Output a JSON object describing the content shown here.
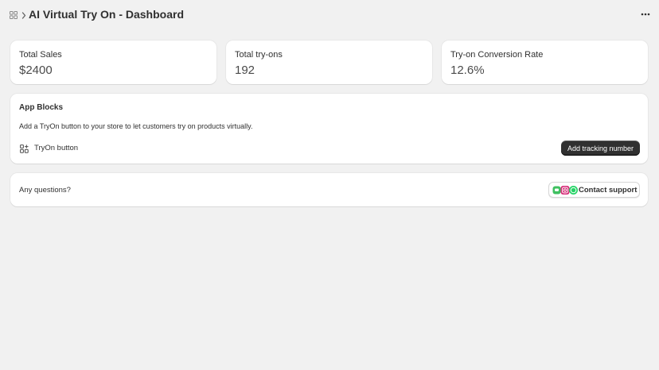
{
  "header": {
    "title": "AI Virtual Try On - Dashboard"
  },
  "stats": [
    {
      "label": "Total Sales",
      "value": "$2400"
    },
    {
      "label": "Total try-ons",
      "value": "192"
    },
    {
      "label": "Try-on Conversion Rate",
      "value": "12.6%"
    }
  ],
  "app_blocks": {
    "title": "App Blocks",
    "description": "Add a TryOn button to your store to let customers try on products virtually.",
    "block_label": "TryOn button",
    "button_label": "Add tracking number"
  },
  "support": {
    "question": "Any questions?",
    "button_label": "Contact support"
  },
  "icons": {
    "app": "app-grid-icon",
    "breadcrumb": "chevron-right-icon",
    "more": "more-horizontal-icon",
    "block": "blocks-icon",
    "channels": [
      "message-icon",
      "instagram-icon",
      "whatsapp-icon"
    ]
  },
  "colors": {
    "background": "#f1f1f1",
    "card": "#ffffff",
    "primary_button": "#303030",
    "whatsapp": "#25d366",
    "message": "#3fc060",
    "instagram": "#d62976"
  }
}
